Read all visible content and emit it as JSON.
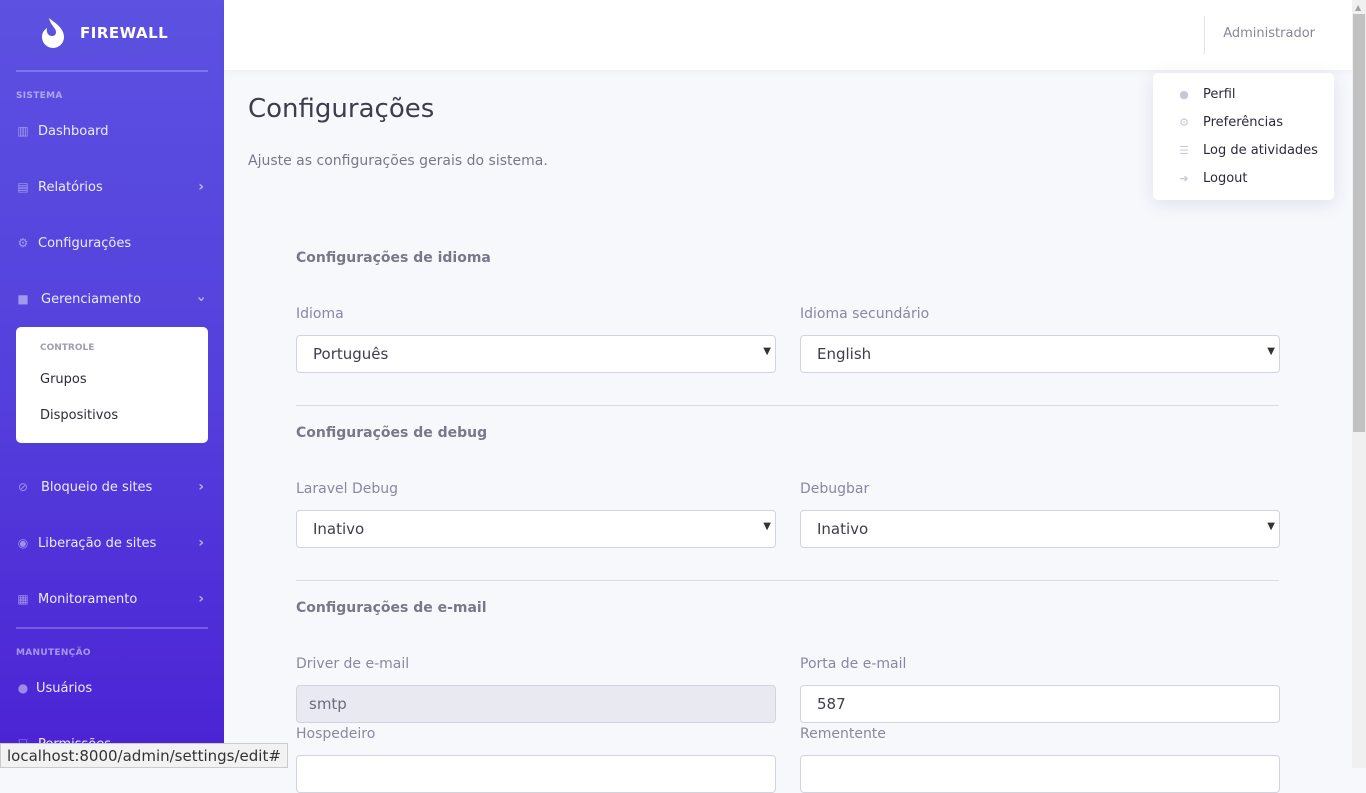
{
  "sidebar": {
    "brand": "FIREWALL",
    "sections": [
      "SISTEMA",
      "MANUTENÇÃO"
    ],
    "items": [
      {
        "label": "Dashboard",
        "icon": "chart-bar-icon"
      },
      {
        "label": "Relatórios",
        "icon": "file-icon"
      },
      {
        "label": "Configurações",
        "icon": "gear-icon"
      },
      {
        "label": "Gerenciamento",
        "icon": "folder-icon"
      },
      {
        "label": "Bloqueio de sites",
        "icon": "eye-slash-icon"
      },
      {
        "label": "Liberação de sites",
        "icon": "eye-icon"
      },
      {
        "label": "Monitoramento",
        "icon": "grid-icon"
      },
      {
        "label": "Usuários",
        "icon": "user-icon"
      },
      {
        "label": "Permissões",
        "icon": "shield-icon"
      }
    ],
    "submenu": {
      "header": "CONTROLE",
      "items": [
        "Grupos",
        "Dispositivos"
      ]
    }
  },
  "topbar": {
    "user": "Administrador"
  },
  "user_menu": [
    {
      "label": "Perfil",
      "icon": "user-icon"
    },
    {
      "label": "Preferências",
      "icon": "gears-icon"
    },
    {
      "label": "Log de atividades",
      "icon": "list-icon"
    },
    {
      "label": "Logout",
      "icon": "sign-out-icon"
    }
  ],
  "page": {
    "title": "Configurações",
    "subtitle": "Ajuste as configurações gerais do sistema."
  },
  "groups": {
    "language": {
      "title": "Configurações de idioma",
      "idioma_label": "Idioma",
      "idioma_value": "Português",
      "sec_label": "Idioma secundário",
      "sec_value": "English"
    },
    "debug": {
      "title": "Configurações de debug",
      "laravel_label": "Laravel Debug",
      "laravel_value": "Inativo",
      "debugbar_label": "Debugbar",
      "debugbar_value": "Inativo"
    },
    "email": {
      "title": "Configurações de e-mail",
      "driver_label": "Driver de e-mail",
      "driver_value": "smtp",
      "port_label": "Porta de e-mail",
      "port_value": "587",
      "host_label": "Hospedeiro",
      "host_value": "",
      "sender_label": "Rementente",
      "sender_value": ""
    }
  },
  "status_bar": "localhost:8000/admin/settings/edit#"
}
